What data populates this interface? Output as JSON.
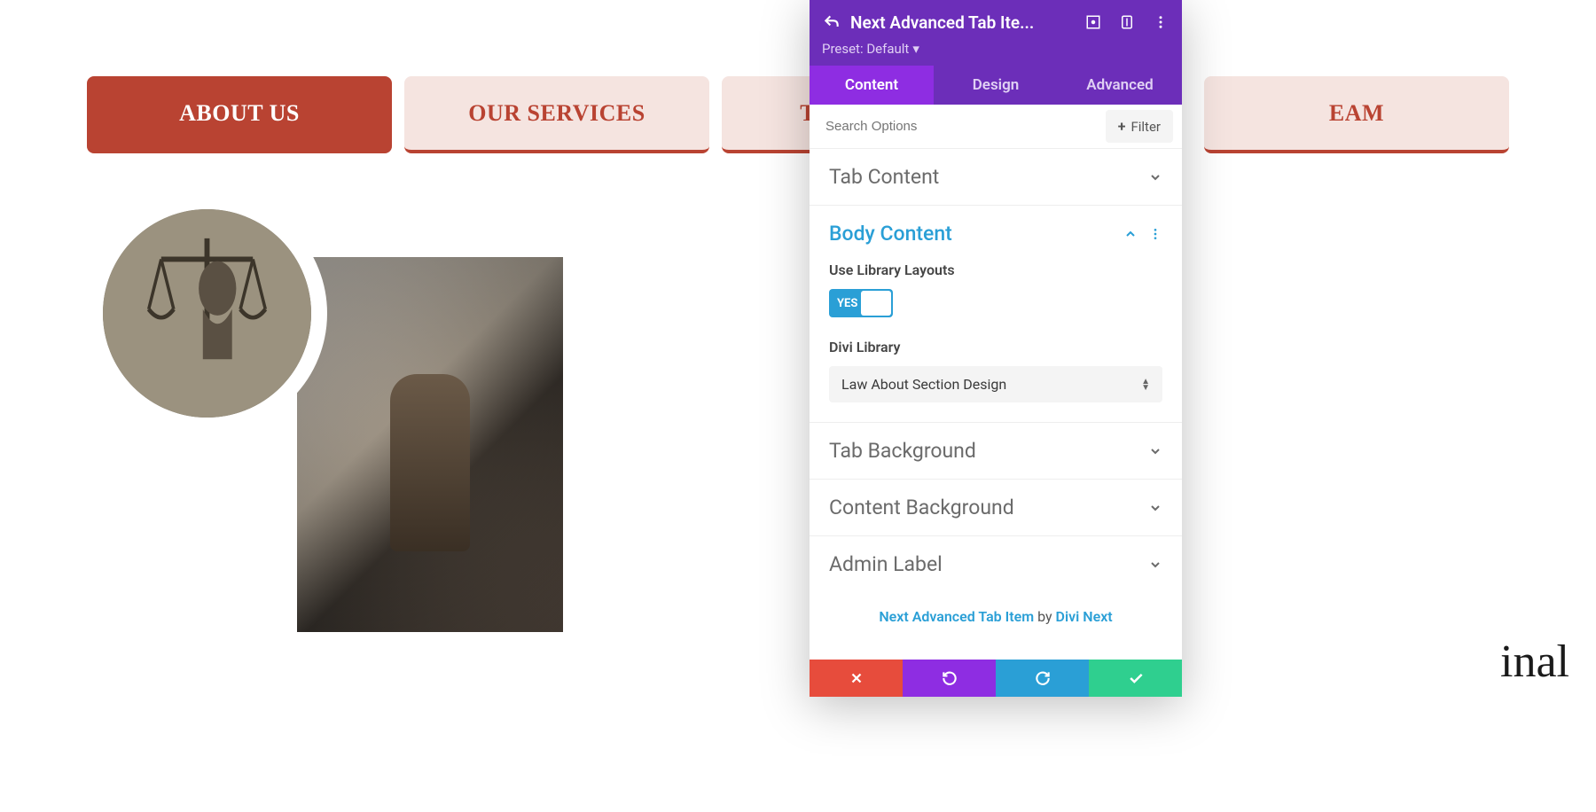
{
  "tabs": {
    "items": [
      {
        "label": "ABOUT US"
      },
      {
        "label": "OUR SERVICES"
      },
      {
        "label": "TRUSTED US"
      },
      {
        "label": "EAM"
      }
    ]
  },
  "trailing_text": "inal",
  "panel": {
    "title": "Next Advanced Tab Ite...",
    "preset_label": "Preset: Default",
    "tabs": {
      "content": "Content",
      "design": "Design",
      "advanced": "Advanced"
    },
    "search": {
      "placeholder": "Search Options",
      "filter_label": "Filter"
    },
    "sections": {
      "tab_content": "Tab Content",
      "body_content": {
        "title": "Body Content",
        "use_library_label": "Use Library Layouts",
        "toggle_value": "YES",
        "divi_library_label": "Divi Library",
        "divi_library_value": "Law About Section Design"
      },
      "tab_background": "Tab Background",
      "content_background": "Content Background",
      "admin_label": "Admin Label"
    },
    "footer": {
      "link1": "Next Advanced Tab Item",
      "by": " by ",
      "link2": "Divi Next"
    }
  }
}
